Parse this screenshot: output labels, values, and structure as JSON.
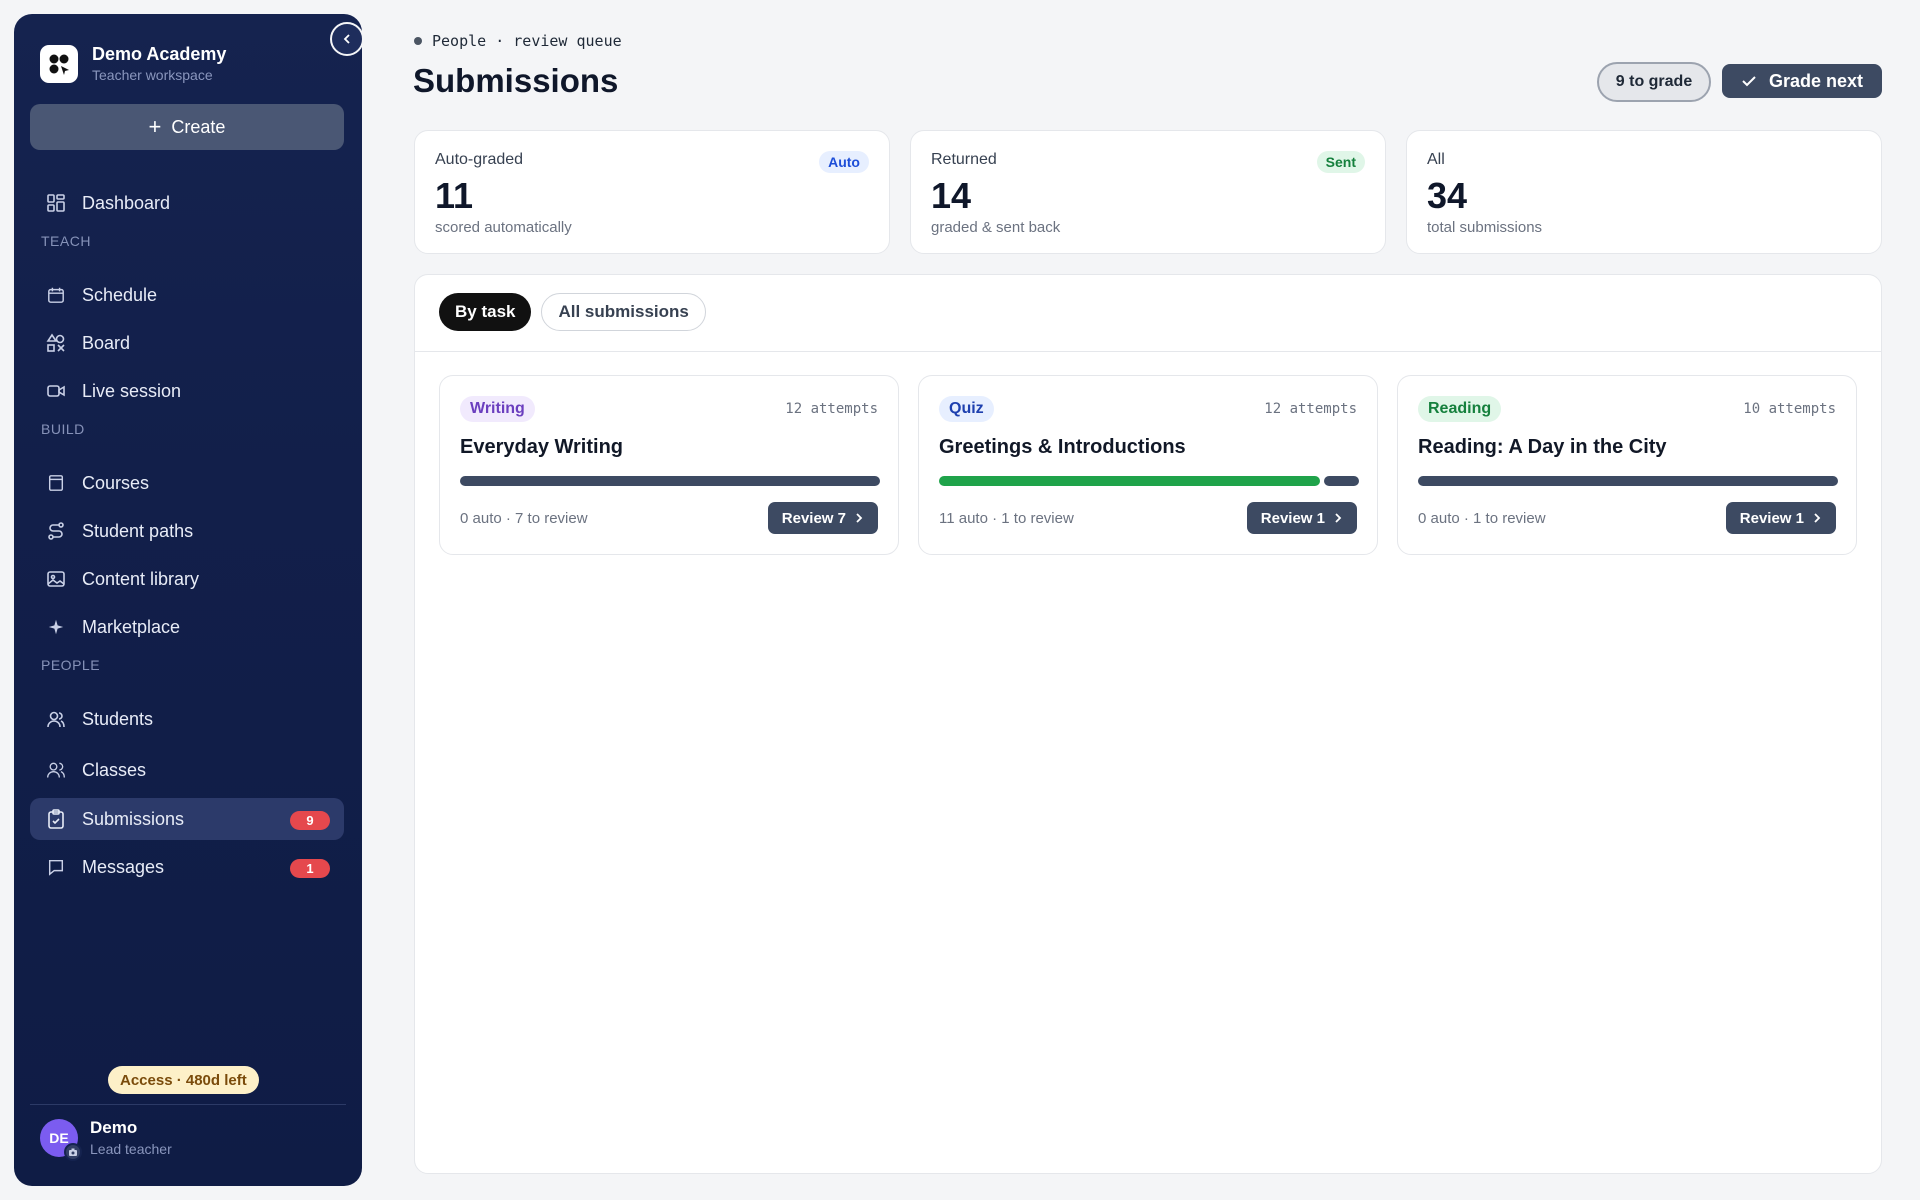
{
  "brand": {
    "name": "Demo Academy",
    "subtitle": "Teacher workspace"
  },
  "sidebar": {
    "create_label": "Create",
    "sections": {
      "teach": "TEACH",
      "build": "BUILD",
      "people": "PEOPLE"
    },
    "items": {
      "dashboard": "Dashboard",
      "schedule": "Schedule",
      "board": "Board",
      "live_session": "Live session",
      "courses": "Courses",
      "student_paths": "Student paths",
      "content_library": "Content library",
      "marketplace": "Marketplace",
      "students": "Students",
      "classes": "Classes",
      "submissions": "Submissions",
      "messages": "Messages"
    },
    "badges": {
      "submissions": "9",
      "messages": "1"
    },
    "access": "Access · 480d left",
    "user": {
      "initials": "DE",
      "name": "Demo",
      "role": "Lead teacher"
    },
    "colors": {
      "background": "#15234f",
      "active": "#2c3a6a",
      "badge": "#e5484d"
    }
  },
  "header": {
    "breadcrumb": "People · review queue",
    "title": "Submissions",
    "to_grade": "9 to grade",
    "grade_next": "Grade next"
  },
  "stats": [
    {
      "label": "Auto-graded",
      "value": "11",
      "sub": "scored automatically",
      "tag": "Auto"
    },
    {
      "label": "Returned",
      "value": "14",
      "sub": "graded & sent back",
      "tag": "Sent"
    },
    {
      "label": "All",
      "value": "34",
      "sub": "total submissions",
      "tag": ""
    }
  ],
  "tabs": {
    "by_task": "By task",
    "all": "All submissions"
  },
  "tasks": [
    {
      "type": "Writing",
      "attempts": "12 attempts",
      "title": "Everyday Writing",
      "meta": "0 auto · 7 to review",
      "review": "Review 7",
      "auto_count": 0,
      "review_count": 7
    },
    {
      "type": "Quiz",
      "attempts": "12 attempts",
      "title": "Greetings & Introductions",
      "meta": "11 auto · 1 to review",
      "review": "Review 1",
      "auto_count": 11,
      "review_count": 1
    },
    {
      "type": "Reading",
      "attempts": "10 attempts",
      "title": "Reading: A Day in the City",
      "meta": "0 auto · 1 to review",
      "review": "Review 1",
      "auto_count": 0,
      "review_count": 1
    }
  ],
  "colors": {
    "accent": "#3d4a62",
    "auto_bar": "#1fa34a",
    "review_bar": "#3d4a62"
  }
}
